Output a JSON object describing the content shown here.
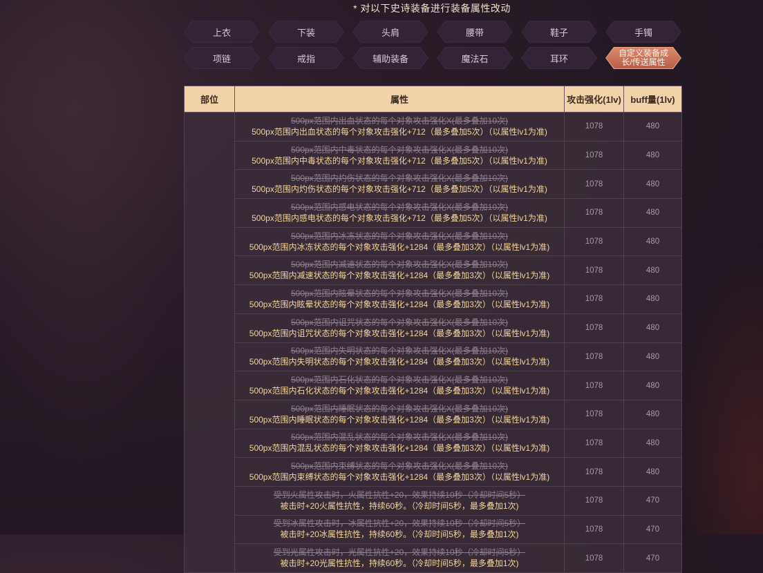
{
  "notice": "* 对以下史诗装备进行装备属性改动",
  "tabs_row1": [
    "上衣",
    "下装",
    "头肩",
    "腰带",
    "鞋子",
    "手镯"
  ],
  "tabs_row2": [
    "项链",
    "戒指",
    "辅助装备",
    "魔法石",
    "耳环",
    "自定义装备成长/传送属性"
  ],
  "active_tab": "自定义装备成长/传送属性",
  "table": {
    "headers": [
      "部位",
      "属性",
      "攻击强化(1lv)",
      "buff量(1lv)"
    ],
    "rows": [
      {
        "old": "500px范围内出血状态的每个对象攻击强化X(最多叠加10次)",
        "new": "500px范围内出血状态的每个对象攻击强化+712（最多叠加5次）（以属性lv1为准)",
        "atk": "1078",
        "buff": "480"
      },
      {
        "old": "500px范围内中毒状态的每个对象攻击强化X(最多叠加10次)",
        "new": "500px范围内中毒状态的每个对象攻击强化+712（最多叠加5次）（以属性lv1为准)",
        "atk": "1078",
        "buff": "480"
      },
      {
        "old": "500px范围内灼伤状态的每个对象攻击强化X(最多叠加10次)",
        "new": "500px范围内灼伤状态的每个对象攻击强化+712（最多叠加5次）（以属性lv1为准)",
        "atk": "1078",
        "buff": "480"
      },
      {
        "old": "500px范围内感电状态的每个对象攻击强化X(最多叠加10次)",
        "new": "500px范围内感电状态的每个对象攻击强化+712（最多叠加5次）（以属性lv1为准)",
        "atk": "1078",
        "buff": "480"
      },
      {
        "old": "500px范围内冰冻状态的每个对象攻击强化X(最多叠加10次)",
        "new": "500px范围内冰冻状态的每个对象攻击强化+1284（最多叠加3次）（以属性lv1为准)",
        "atk": "1078",
        "buff": "480"
      },
      {
        "old": "500px范围内减速状态的每个对象攻击强化X(最多叠加10次)",
        "new": "500px范围内减速状态的每个对象攻击强化+1284（最多叠加3次）（以属性lv1为准)",
        "atk": "1078",
        "buff": "480"
      },
      {
        "old": "500px范围内眩晕状态的每个对象攻击强化X(最多叠加10次)",
        "new": "500px范围内眩晕状态的每个对象攻击强化+1284（最多叠加3次）（以属性lv1为准)",
        "atk": "1078",
        "buff": "480"
      },
      {
        "old": "500px范围内诅咒状态的每个对象攻击强化X(最多叠加10次)",
        "new": "500px范围内诅咒状态的每个对象攻击强化+1284（最多叠加3次）（以属性lv1为准)",
        "atk": "1078",
        "buff": "480"
      },
      {
        "old": "500px范围内失明状态的每个对象攻击强化X(最多叠加10次)",
        "new": "500px范围内失明状态的每个对象攻击强化+1284（最多叠加3次）（以属性lv1为准)",
        "atk": "1078",
        "buff": "480"
      },
      {
        "old": "500px范围内石化状态的每个对象攻击强化X(最多叠加10次)",
        "new": "500px范围内石化状态的每个对象攻击强化+1284（最多叠加3次）（以属性lv1为准)",
        "atk": "1078",
        "buff": "480"
      },
      {
        "old": "500px范围内睡眠状态的每个对象攻击强化X(最多叠加10次)",
        "new": "500px范围内睡眠状态的每个对象攻击强化+1284（最多叠加3次）（以属性lv1为准)",
        "atk": "1078",
        "buff": "480"
      },
      {
        "old": "500px范围内混乱状态的每个对象攻击强化X(最多叠加10次)",
        "new": "500px范围内混乱状态的每个对象攻击强化+1284（最多叠加3次）（以属性lv1为准)",
        "atk": "1078",
        "buff": "480"
      },
      {
        "old": "500px范围内束缚状态的每个对象攻击强化X(最多叠加10次)",
        "new": "500px范围内束缚状态的每个对象攻击强化+1284（最多叠加3次）（以属性lv1为准)",
        "atk": "1078",
        "buff": "480"
      },
      {
        "old": "受到火属性攻击时，火属性抗性+20，效果持续10秒（冷却时间5秒）",
        "new": "被击时+20火属性抗性，持续60秒。（冷却时间5秒，最多叠加1次)",
        "atk": "1078",
        "buff": "470"
      },
      {
        "old": "受到冰属性攻击时，冰属性抗性+20，效果持续10秒（冷却时间5秒）",
        "new": "被击时+20冰属性抗性，持续60秒。（冷却时间5秒，最多叠加1次)",
        "atk": "1078",
        "buff": "470"
      },
      {
        "old": "受到光属性攻击时，光属性抗性+20，效果持续10秒（冷却时间5秒）",
        "new": "被击时+20光属性抗性，持续60秒。（冷却时间5秒，最多叠加1次)",
        "atk": "1078",
        "buff": "470"
      }
    ]
  }
}
